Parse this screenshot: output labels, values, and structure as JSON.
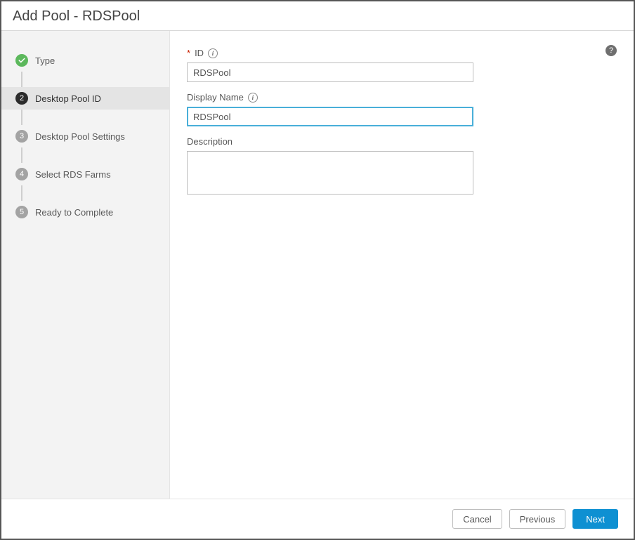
{
  "dialog_title": "Add Pool - RDSPool",
  "sidebar": {
    "steps": [
      {
        "label": "Type",
        "state": "done"
      },
      {
        "label": "Desktop Pool ID",
        "state": "active"
      },
      {
        "label": "Desktop Pool Settings",
        "state": "pending"
      },
      {
        "label": "Select RDS Farms",
        "state": "pending"
      },
      {
        "label": "Ready to Complete",
        "state": "pending"
      }
    ]
  },
  "form": {
    "id_label": "ID",
    "id_value": "RDSPool",
    "display_name_label": "Display Name",
    "display_name_value": "RDSPool",
    "description_label": "Description",
    "description_value": ""
  },
  "footer": {
    "cancel": "Cancel",
    "previous": "Previous",
    "next": "Next"
  }
}
